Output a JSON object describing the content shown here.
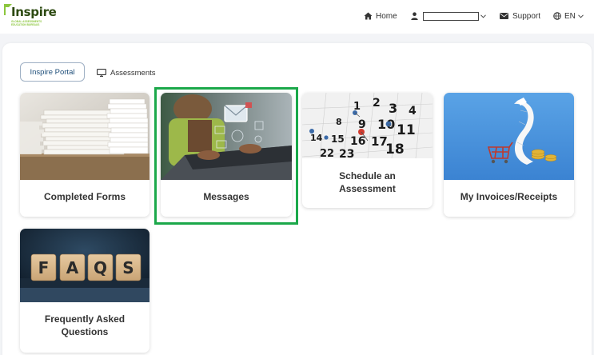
{
  "brand": {
    "name": "Inspire",
    "tagline": "GLOBAL ASSESSMENTS EDUCATION BUREAUS"
  },
  "nav": {
    "home_label": "Home",
    "user_value": "",
    "support_label": "Support",
    "lang_label": "EN"
  },
  "breadcrumb": {
    "portal_label": "Inspire Portal",
    "assessments_label": "Assessments"
  },
  "cards": [
    {
      "id": "completed-forms",
      "label": "Completed Forms",
      "image": "stacked-papers"
    },
    {
      "id": "messages",
      "label": "Messages",
      "image": "laptop-email",
      "highlighted": true
    },
    {
      "id": "schedule-assessment",
      "label": "Schedule an Assessment",
      "image": "calendar-pins"
    },
    {
      "id": "invoices-receipts",
      "label": "My Invoices/Receipts",
      "image": "receipt-cart"
    },
    {
      "id": "faqs",
      "label": "Frequently Asked Questions",
      "image": "faqs-blocks"
    }
  ],
  "faq_letters": [
    "F",
    "A",
    "Q",
    "S"
  ],
  "calendar_numbers": [
    "1",
    "2",
    "3",
    "4",
    "8",
    "9",
    "10",
    "11",
    "14",
    "15",
    "16",
    "17",
    "18",
    "22",
    "23"
  ],
  "colors": {
    "highlight": "#1ba84a",
    "brand_dark": "#2d4a12",
    "brand_light": "#8cc63e",
    "portal_text": "#1f4f7a"
  }
}
